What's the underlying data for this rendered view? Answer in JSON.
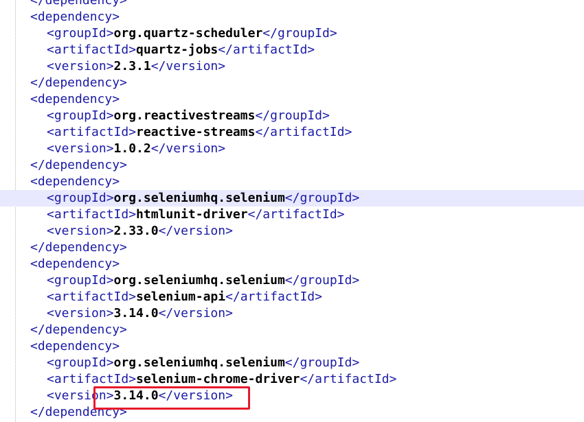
{
  "editor": {
    "highlight_color": "#e8192b",
    "tag_color": "#1a1aa6",
    "current_line_color": "#e8e8ff",
    "lines": [
      {
        "indent": 0,
        "open": "</dependency>",
        "value": "",
        "close": ""
      },
      {
        "indent": 0,
        "open": "<dependency>",
        "value": "",
        "close": ""
      },
      {
        "indent": 1,
        "open": "<groupId>",
        "value": "org.quartz-scheduler",
        "close": "</groupId>"
      },
      {
        "indent": 1,
        "open": "<artifactId>",
        "value": "quartz-jobs",
        "close": "</artifactId>"
      },
      {
        "indent": 1,
        "open": "<version>",
        "value": "2.3.1",
        "close": "</version>"
      },
      {
        "indent": 0,
        "open": "</dependency>",
        "value": "",
        "close": ""
      },
      {
        "indent": 0,
        "open": "<dependency>",
        "value": "",
        "close": ""
      },
      {
        "indent": 1,
        "open": "<groupId>",
        "value": "org.reactivestreams",
        "close": "</groupId>"
      },
      {
        "indent": 1,
        "open": "<artifactId>",
        "value": "reactive-streams",
        "close": "</artifactId>"
      },
      {
        "indent": 1,
        "open": "<version>",
        "value": "1.0.2",
        "close": "</version>"
      },
      {
        "indent": 0,
        "open": "</dependency>",
        "value": "",
        "close": ""
      },
      {
        "indent": 0,
        "open": "<dependency>",
        "value": "",
        "close": ""
      },
      {
        "indent": 1,
        "open": "<groupId>",
        "value": "org.seleniumhq.selenium",
        "close": "</groupId>",
        "current": true
      },
      {
        "indent": 1,
        "open": "<artifactId>",
        "value": "htmlunit-driver",
        "close": "</artifactId>"
      },
      {
        "indent": 1,
        "open": "<version>",
        "value": "2.33.0",
        "close": "</version>"
      },
      {
        "indent": 0,
        "open": "</dependency>",
        "value": "",
        "close": ""
      },
      {
        "indent": 0,
        "open": "<dependency>",
        "value": "",
        "close": ""
      },
      {
        "indent": 1,
        "open": "<groupId>",
        "value": "org.seleniumhq.selenium",
        "close": "</groupId>"
      },
      {
        "indent": 1,
        "open": "<artifactId>",
        "value": "selenium-api",
        "close": "</artifactId>"
      },
      {
        "indent": 1,
        "open": "<version>",
        "value": "3.14.0",
        "close": "</version>"
      },
      {
        "indent": 0,
        "open": "</dependency>",
        "value": "",
        "close": ""
      },
      {
        "indent": 0,
        "open": "<dependency>",
        "value": "",
        "close": ""
      },
      {
        "indent": 1,
        "open": "<groupId>",
        "value": "org.seleniumhq.selenium",
        "close": "</groupId>"
      },
      {
        "indent": 1,
        "open": "<artifactId>",
        "value": "selenium-chrome-driver",
        "close": "</artifactId>"
      },
      {
        "indent": 1,
        "open": "<version>",
        "value": "3.14.0",
        "close": "</version>",
        "highlighted": true
      },
      {
        "indent": 0,
        "open": "</dependency>",
        "value": "",
        "close": ""
      }
    ]
  }
}
